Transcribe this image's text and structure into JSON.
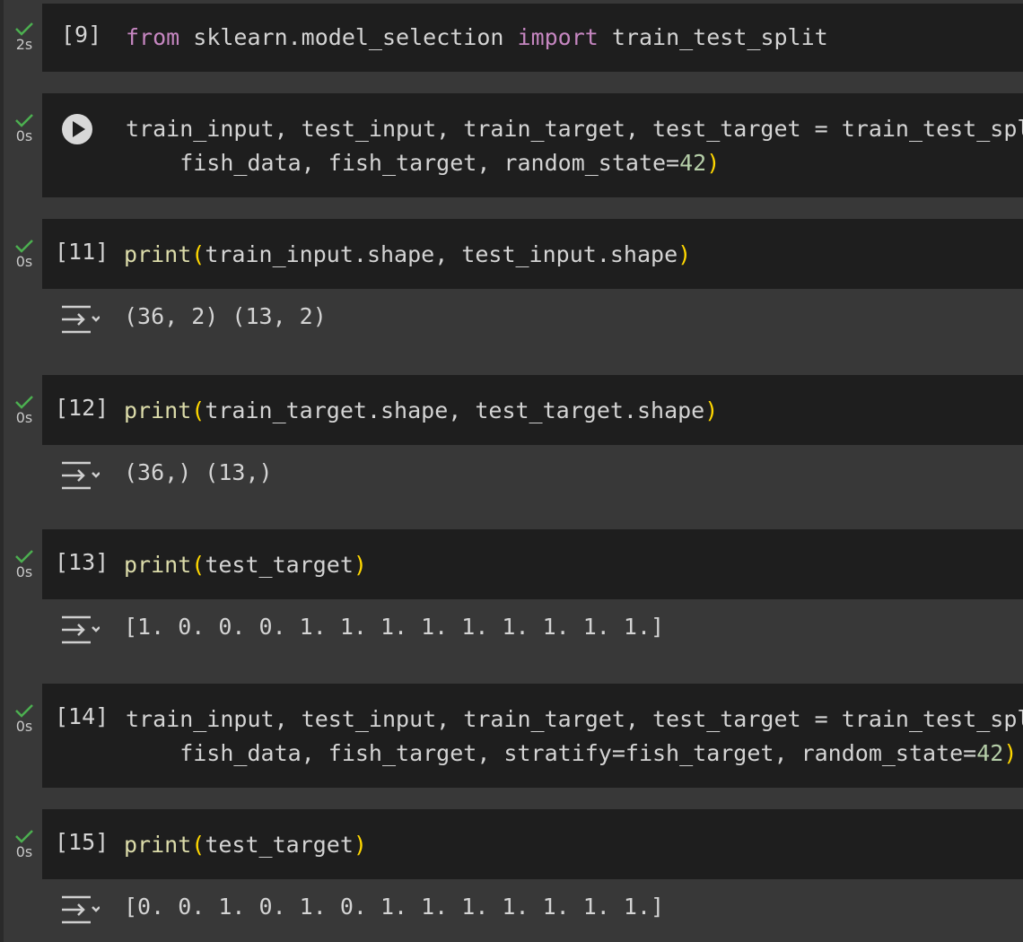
{
  "cells": [
    {
      "id": "c9",
      "exec": "[9]",
      "time": "2s",
      "code": [
        {
          "t": "from",
          "c": "kw"
        },
        {
          "t": " sklearn.model_selection "
        },
        {
          "t": "import",
          "c": "kw"
        },
        {
          "t": " train_test_split"
        }
      ]
    },
    {
      "id": "c10",
      "exec": "",
      "time": "0s",
      "code_lines": [
        [
          {
            "t": "train_input, test_input, train_target, test_target = train_test_split"
          },
          {
            "t": "(",
            "c": "paren"
          }
        ],
        [
          {
            "t": "    fish_data, fish_target, random_state="
          },
          {
            "t": "42",
            "c": "num"
          },
          {
            "t": ")",
            "c": "paren"
          }
        ]
      ]
    },
    {
      "id": "c11",
      "exec": "[11]",
      "time": "0s",
      "code": [
        {
          "t": "print",
          "c": "fn"
        },
        {
          "t": "(",
          "c": "paren"
        },
        {
          "t": "train_input.shape, test_input.shape"
        },
        {
          "t": ")",
          "c": "paren"
        }
      ],
      "output": "(36, 2) (13, 2)"
    },
    {
      "id": "c12",
      "exec": "[12]",
      "time": "0s",
      "code": [
        {
          "t": "print",
          "c": "fn"
        },
        {
          "t": "(",
          "c": "paren"
        },
        {
          "t": "train_target.shape, test_target.shape"
        },
        {
          "t": ")",
          "c": "paren"
        }
      ],
      "output": "(36,) (13,)"
    },
    {
      "id": "c13",
      "exec": "[13]",
      "time": "0s",
      "code": [
        {
          "t": "print",
          "c": "fn"
        },
        {
          "t": "(",
          "c": "paren"
        },
        {
          "t": "test_target"
        },
        {
          "t": ")",
          "c": "paren"
        }
      ],
      "output": "[1. 0. 0. 0. 1. 1. 1. 1. 1. 1. 1. 1. 1.]"
    },
    {
      "id": "c14",
      "exec": "[14]",
      "time": "0s",
      "code_lines": [
        [
          {
            "t": "train_input, test_input, train_target, test_target = train_test_split"
          },
          {
            "t": "(",
            "c": "paren"
          }
        ],
        [
          {
            "t": "    fish_data, fish_target, stratify=fish_target, random_state="
          },
          {
            "t": "42",
            "c": "num"
          },
          {
            "t": ")",
            "c": "paren"
          }
        ]
      ]
    },
    {
      "id": "c15",
      "exec": "[15]",
      "time": "0s",
      "code": [
        {
          "t": "print",
          "c": "fn"
        },
        {
          "t": "(",
          "c": "paren"
        },
        {
          "t": "test_target"
        },
        {
          "t": ")",
          "c": "paren"
        }
      ],
      "output": "[0. 0. 1. 0. 1. 0. 1. 1. 1. 1. 1. 1. 1.]"
    }
  ],
  "colors": {
    "keyword": "#c586c0",
    "function": "#dcdcaa",
    "paren": "#ffd700",
    "number": "#b5cea8",
    "check": "#4caf50"
  },
  "icons": {
    "status": "check-icon",
    "run": "play-icon",
    "output": "output-toggle-icon"
  }
}
